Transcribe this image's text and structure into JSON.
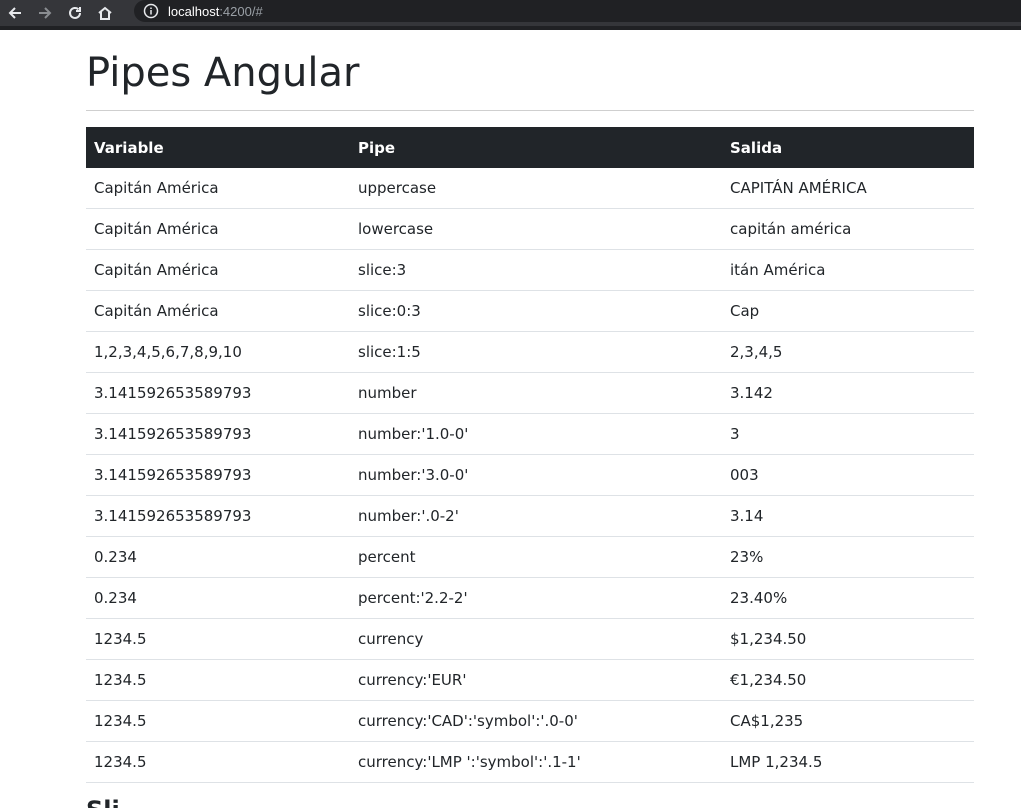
{
  "browser": {
    "url_host": "localhost",
    "url_rest": ":4200/#"
  },
  "page": {
    "title": "Pipes Angular"
  },
  "table": {
    "headers": [
      "Variable",
      "Pipe",
      "Salida"
    ],
    "rows": [
      [
        "Capitán América",
        "uppercase",
        "CAPITÁN AMÉRICA"
      ],
      [
        "Capitán América",
        "lowercase",
        "capitán américa"
      ],
      [
        "Capitán América",
        "slice:3",
        "itán América"
      ],
      [
        "Capitán América",
        "slice:0:3",
        "Cap"
      ],
      [
        "1,2,3,4,5,6,7,8,9,10",
        "slice:1:5",
        "2,3,4,5"
      ],
      [
        "3.141592653589793",
        "number",
        "3.142"
      ],
      [
        "3.141592653589793",
        "number:'1.0-0'",
        "3"
      ],
      [
        "3.141592653589793",
        "number:'3.0-0'",
        "003"
      ],
      [
        "3.141592653589793",
        "number:'.0-2'",
        "3.14"
      ],
      [
        "0.234",
        "percent",
        "23%"
      ],
      [
        "0.234",
        "percent:'2.2-2'",
        "23.40%"
      ],
      [
        "1234.5",
        "currency",
        "$1,234.50"
      ],
      [
        "1234.5",
        "currency:'EUR'",
        "€1,234.50"
      ],
      [
        "1234.5",
        "currency:'CAD':'symbol':'.0-0'",
        "CA$1,235"
      ],
      [
        "1234.5",
        "currency:'LMP ':'symbol':'.1-1'",
        "LMP 1,234.5"
      ]
    ]
  },
  "next_section": {
    "heading": "Sli"
  }
}
